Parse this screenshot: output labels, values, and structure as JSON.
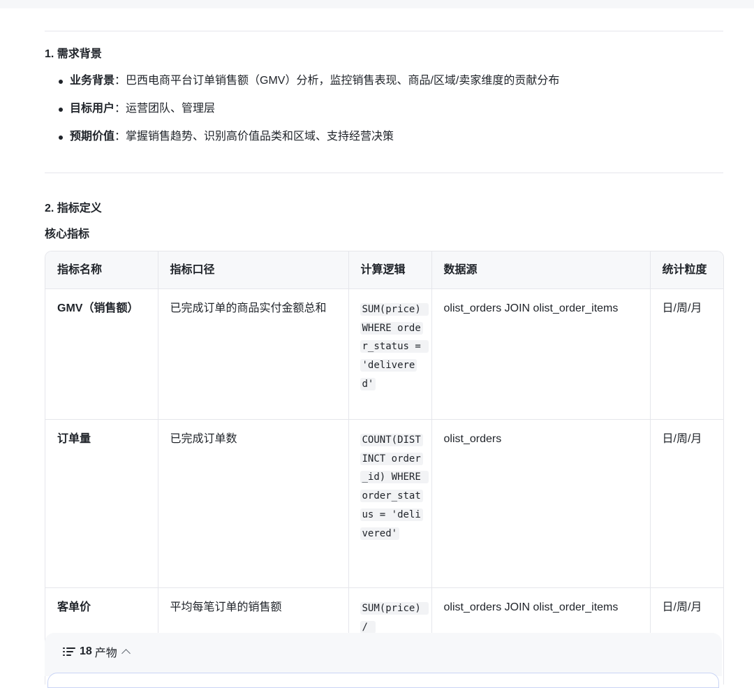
{
  "section1": {
    "heading": "1. 需求背景",
    "items": [
      {
        "label": "业务背景",
        "text": "：巴西电商平台订单销售额（GMV）分析，监控销售表现、商品/区域/卖家维度的贡献分布"
      },
      {
        "label": "目标用户",
        "text": "：运营团队、管理层"
      },
      {
        "label": "预期价值",
        "text": "：掌握销售趋势、识别高价值品类和区域、支持经营决策"
      }
    ]
  },
  "section2": {
    "heading": "2. 指标定义",
    "subheading": "核心指标"
  },
  "table": {
    "headers": [
      "指标名称",
      "指标口径",
      "计算逻辑",
      "数据源",
      "统计粒度"
    ],
    "rows": [
      {
        "name": "GMV（销售额）",
        "caliber": "已完成订单的商品实付金额总和",
        "logic": "SUM(price) WHERE order_status = 'delivered'",
        "source": "olist_orders JOIN olist_order_items",
        "granularity": "日/周/月"
      },
      {
        "name": "订单量",
        "caliber": "已完成订单数",
        "logic": "COUNT(DISTINCT order_id) WHERE order_status = 'delivered'",
        "source": "olist_orders",
        "granularity": "日/周/月"
      },
      {
        "name": "客单价",
        "caliber": "平均每笔订单的销售额",
        "logic": "SUM(price) / ",
        "source": "olist_orders JOIN olist_order_items",
        "granularity": "日/周/月"
      }
    ]
  },
  "artifacts": {
    "count": "18",
    "label": "产物",
    "icon": "list-icon",
    "toggle_icon": "chevron-up-icon"
  }
}
